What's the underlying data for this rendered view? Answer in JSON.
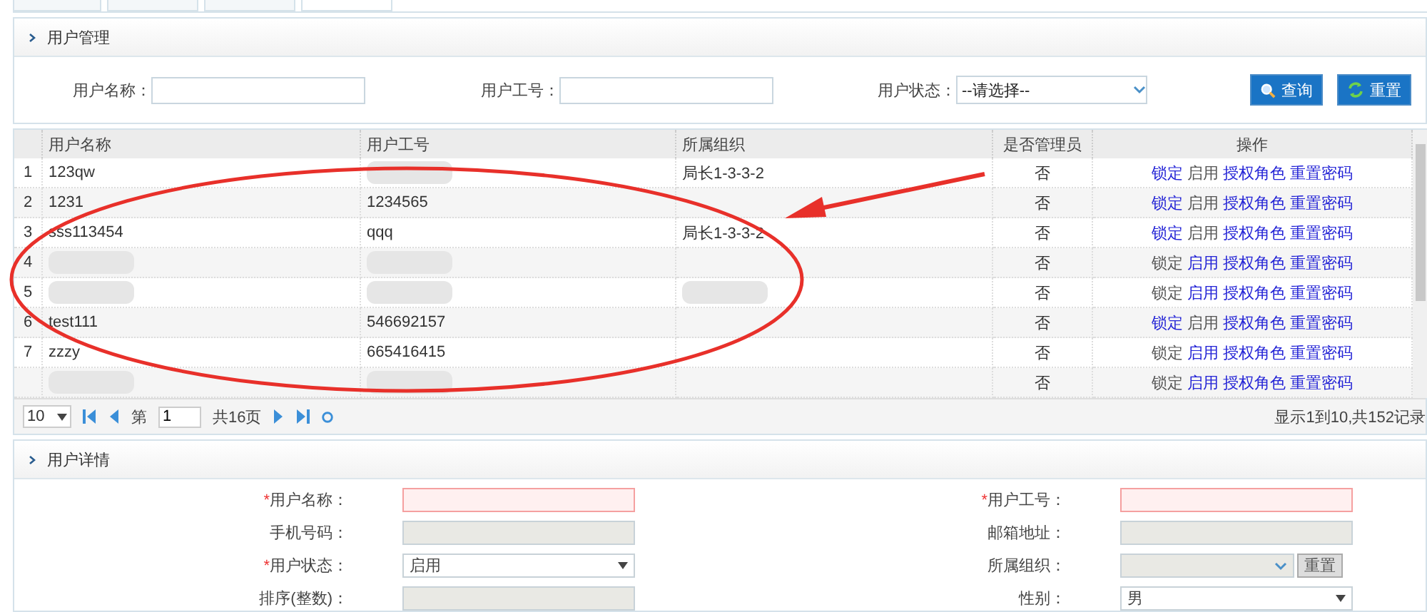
{
  "search_panel": {
    "title": "用户管理",
    "fields": [
      {
        "kind": "text",
        "label": "用户名称："
      },
      {
        "kind": "text",
        "label": "用户工号："
      },
      {
        "kind": "select",
        "label": "用户状态：",
        "value": "--请选择--"
      }
    ],
    "buttons": [
      {
        "kind": "search",
        "label": "查询"
      },
      {
        "kind": "refresh",
        "label": "重置"
      }
    ]
  },
  "table": {
    "columns": [
      "用户名称",
      "用户工号",
      "所属组织",
      "是否管理员",
      "操作"
    ],
    "rows": [
      {
        "index": "1",
        "cells": [
          {
            "text": "123qw"
          },
          {
            "blurred": true
          },
          {
            "text": "局长1-3-3-2"
          },
          {
            "text": "否"
          }
        ],
        "actions": [
          {
            "label": "锁定",
            "disabled": false
          },
          {
            "label": "启用",
            "disabled": true
          },
          {
            "label": "授权角色",
            "disabled": false
          },
          {
            "label": "重置密码",
            "disabled": false
          }
        ]
      },
      {
        "index": "2",
        "cells": [
          {
            "text": "1231"
          },
          {
            "text": "1234565"
          },
          {
            "text": ""
          },
          {
            "text": "否"
          }
        ],
        "actions": [
          {
            "label": "锁定",
            "disabled": false
          },
          {
            "label": "启用",
            "disabled": true
          },
          {
            "label": "授权角色",
            "disabled": false
          },
          {
            "label": "重置密码",
            "disabled": false
          }
        ]
      },
      {
        "index": "3",
        "cells": [
          {
            "text": "sss113454"
          },
          {
            "text": "qqq"
          },
          {
            "text": "局长1-3-3-2"
          },
          {
            "text": "否"
          }
        ],
        "actions": [
          {
            "label": "锁定",
            "disabled": false
          },
          {
            "label": "启用",
            "disabled": true
          },
          {
            "label": "授权角色",
            "disabled": false
          },
          {
            "label": "重置密码",
            "disabled": false
          }
        ]
      },
      {
        "index": "4",
        "cells": [
          {
            "blurred": true
          },
          {
            "blurred": true
          },
          {
            "text": ""
          },
          {
            "text": "否"
          }
        ],
        "actions": [
          {
            "label": "锁定",
            "disabled": true
          },
          {
            "label": "启用",
            "disabled": false
          },
          {
            "label": "授权角色",
            "disabled": false
          },
          {
            "label": "重置密码",
            "disabled": false
          }
        ]
      },
      {
        "index": "5",
        "cells": [
          {
            "blurred": true
          },
          {
            "blurred": true
          },
          {
            "blurred": true
          },
          {
            "text": "否"
          }
        ],
        "actions": [
          {
            "label": "锁定",
            "disabled": true
          },
          {
            "label": "启用",
            "disabled": false
          },
          {
            "label": "授权角色",
            "disabled": false
          },
          {
            "label": "重置密码",
            "disabled": false
          }
        ]
      },
      {
        "index": "6",
        "cells": [
          {
            "text": "test111"
          },
          {
            "text": "546692157"
          },
          {
            "text": ""
          },
          {
            "text": "否"
          }
        ],
        "actions": [
          {
            "label": "锁定",
            "disabled": false
          },
          {
            "label": "启用",
            "disabled": true
          },
          {
            "label": "授权角色",
            "disabled": false
          },
          {
            "label": "重置密码",
            "disabled": false
          }
        ]
      },
      {
        "index": "7",
        "cells": [
          {
            "text": "zzzy"
          },
          {
            "text": "665416415"
          },
          {
            "text": ""
          },
          {
            "text": "否"
          }
        ],
        "actions": [
          {
            "label": "锁定",
            "disabled": true
          },
          {
            "label": "启用",
            "disabled": false
          },
          {
            "label": "授权角色",
            "disabled": false
          },
          {
            "label": "重置密码",
            "disabled": false
          }
        ]
      },
      {
        "index": "",
        "cells": [
          {
            "blurred": true
          },
          {
            "blurred": true
          },
          {
            "text": ""
          },
          {
            "text": "否"
          }
        ],
        "actions": [
          {
            "label": "锁定",
            "disabled": true
          },
          {
            "label": "启用",
            "disabled": false
          },
          {
            "label": "授权角色",
            "disabled": false
          },
          {
            "label": "重置密码",
            "disabled": false
          }
        ]
      }
    ]
  },
  "pager": {
    "page_size": "10",
    "page_label": "第",
    "page": "1",
    "total_pages": "共16页",
    "summary": "显示1到10,共152记录"
  },
  "detail_panel": {
    "title": "用户详情",
    "rows": [
      [
        {
          "mark": "*",
          "label": "用户名称：",
          "kind": "text",
          "invalid": true,
          "disabled": false
        },
        {
          "mark": "*",
          "label": "用户工号：",
          "kind": "text",
          "invalid": true,
          "disabled": false
        }
      ],
      [
        {
          "label": "手机号码：",
          "kind": "text",
          "invalid": false,
          "disabled": true
        },
        {
          "label": "邮箱地址：",
          "kind": "text",
          "invalid": false,
          "disabled": true
        }
      ],
      [
        {
          "mark": "*",
          "label": "用户状态：",
          "kind": "select",
          "value": "启用",
          "invalid": false,
          "disabled": false
        },
        {
          "label": "所属组织：",
          "kind": "combo",
          "button": "重置",
          "invalid": false,
          "disabled": true
        }
      ],
      [
        {
          "label": "排序(整数)：",
          "kind": "text",
          "invalid": false,
          "disabled": true
        },
        {
          "label": "性别：",
          "kind": "select",
          "value": "男",
          "invalid": false,
          "disabled": false
        }
      ]
    ]
  }
}
